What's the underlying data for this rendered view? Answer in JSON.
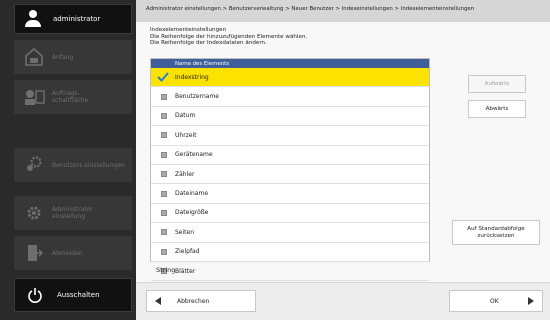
{
  "sidebar": {
    "user_label": "administrator",
    "items": [
      {
        "label_line1": "Anfang",
        "label_line2": ""
      },
      {
        "label_line1": "Auftrags-",
        "label_line2": "schaltfläche"
      },
      {
        "label_line1": "Benutzers einstellungen",
        "label_line2": ""
      },
      {
        "label_line1": "Administrator",
        "label_line2": "einstellung"
      },
      {
        "label_line1": "Abmelden",
        "label_line2": ""
      }
    ],
    "power_label": "Ausschalten"
  },
  "breadcrumb": "Administrator einstellungen > Benutzerverwaltung > Neuer Benutzer > Indexeinstellungen > Indexelementeinstellungen",
  "intro": {
    "line1": "Indexelementeinstellungen",
    "line2": "Die Reihenfolge der hinzuzufügenden Elemente wählen.",
    "line3": "Die Reihenfolge der Indexdateien ändern."
  },
  "list": {
    "header": "Name des Elements",
    "items": [
      {
        "label": "Indexstring",
        "selected": true
      },
      {
        "label": "Benutzername",
        "selected": false
      },
      {
        "label": "Datum",
        "selected": false
      },
      {
        "label": "Uhrzeit",
        "selected": false
      },
      {
        "label": "Gerätename",
        "selected": false
      },
      {
        "label": "Zähler",
        "selected": false
      },
      {
        "label": "Dateiname",
        "selected": false
      },
      {
        "label": "Dateigröße",
        "selected": false
      },
      {
        "label": "Seiten",
        "selected": false
      },
      {
        "label": "Zielpfad",
        "selected": false
      },
      {
        "label": "Blätter",
        "selected": false
      }
    ]
  },
  "status_text": "String",
  "buttons": {
    "up": "Aufwärts",
    "down": "Abwärts",
    "reset_line1": "Auf Standardabfolge",
    "reset_line2": "zurücksetzen",
    "cancel": "Abbrechen",
    "ok": "OK"
  },
  "colors": {
    "selected_row": "#fce200",
    "header_bg": "#3e5f9a",
    "check": "#2a7fd4"
  }
}
